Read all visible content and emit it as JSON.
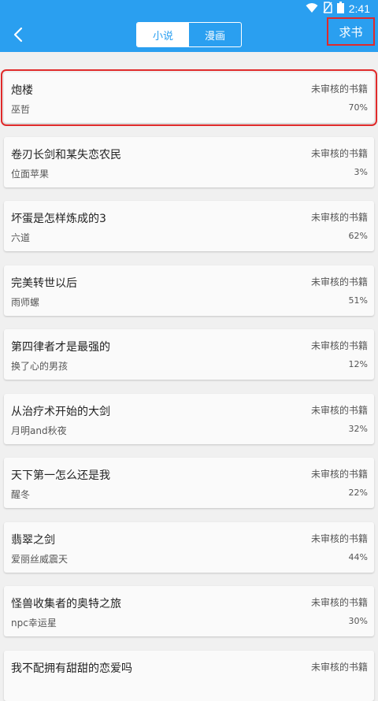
{
  "status_bar": {
    "time": "2:41"
  },
  "header": {
    "tabs": [
      {
        "label": "小说",
        "active": true
      },
      {
        "label": "漫画",
        "active": false
      }
    ],
    "request_label": "求书"
  },
  "books": [
    {
      "title": "炮楼",
      "author": "巫哲",
      "status": "未审核的书籍",
      "percent": "70%"
    },
    {
      "title": "卷刃长剑和某失恋农民",
      "author": "位面苹果",
      "status": "未审核的书籍",
      "percent": "3%"
    },
    {
      "title": "坏蛋是怎样炼成的3",
      "author": "六道",
      "status": "未审核的书籍",
      "percent": "62%"
    },
    {
      "title": "完美转世以后",
      "author": "雨师螺",
      "status": "未审核的书籍",
      "percent": "51%"
    },
    {
      "title": "第四律者才是最强的",
      "author": "换了心的男孩",
      "status": "未审核的书籍",
      "percent": "12%"
    },
    {
      "title": "从治疗术开始的大剑",
      "author": "月明and秋夜",
      "status": "未审核的书籍",
      "percent": "32%"
    },
    {
      "title": "天下第一怎么还是我",
      "author": "醒冬",
      "status": "未审核的书籍",
      "percent": "22%"
    },
    {
      "title": "翡翠之剑",
      "author": "爱丽丝威震天",
      "status": "未审核的书籍",
      "percent": "44%"
    },
    {
      "title": "怪兽收集者的奥特之旅",
      "author": "npc幸运星",
      "status": "未审核的书籍",
      "percent": "30%"
    },
    {
      "title": "我不配拥有甜甜的恋爱吗",
      "author": "",
      "status": "未审核的书籍",
      "percent": ""
    }
  ],
  "colors": {
    "accent": "#2a9ff0",
    "highlight": "#e02a2a",
    "background": "#f0f0f0"
  }
}
